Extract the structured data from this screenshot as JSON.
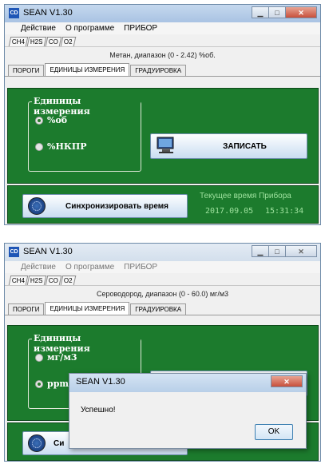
{
  "windows": [
    {
      "title": "SEAN V1.30",
      "menu": [
        "Действие",
        "О программе",
        "ПРИБОР"
      ],
      "gas_tabs": [
        "CH4",
        "H2S",
        "CO",
        "O2"
      ],
      "range_text": "Метан, диапазон (0 - 2.42) %об.",
      "main_tabs": [
        "ПОРОГИ",
        "ЕДИНИЦЫ ИЗМЕРЕНИЯ",
        "ГРАДУИРОВКА"
      ],
      "selected_main_tab": "ЕДИНИЦЫ ИЗМЕРЕНИЯ",
      "units_group_title": "Единицы измерения",
      "unit_options": [
        "%об",
        "%НКПР"
      ],
      "selected_unit": "%об",
      "write_button": "ЗАПИСАТЬ",
      "sync_button": "Синхронизировать время",
      "device_time_label": "Текущее время Прибора",
      "device_date": "2017.09.05",
      "device_time": "15:31:34"
    },
    {
      "title": "SEAN V1.30",
      "menu": [
        "Действие",
        "О программе",
        "ПРИБОР"
      ],
      "gas_tabs": [
        "CH4",
        "H2S",
        "CO",
        "O2"
      ],
      "range_text": "Сероводород, диапазон (0 - 60.0) мг/м3",
      "main_tabs": [
        "ПОРОГИ",
        "ЕДИНИЦЫ ИЗМЕРЕНИЯ",
        "ГРАДУИРОВКА"
      ],
      "selected_main_tab": "ЕДИНИЦЫ ИЗМЕРЕНИЯ",
      "units_group_title": "Единицы измерения",
      "unit_options": [
        "мг/м3",
        "ppm"
      ],
      "selected_unit": "ppm",
      "sync_button_partial": "Си"
    }
  ],
  "dialog": {
    "title": "SEAN V1.30",
    "message": "Успешно!",
    "ok_button": "OK"
  },
  "colors": {
    "panel_green": "#1c7b2d",
    "title_active": "#a9c3e3",
    "time_text": "#9ee29e"
  }
}
